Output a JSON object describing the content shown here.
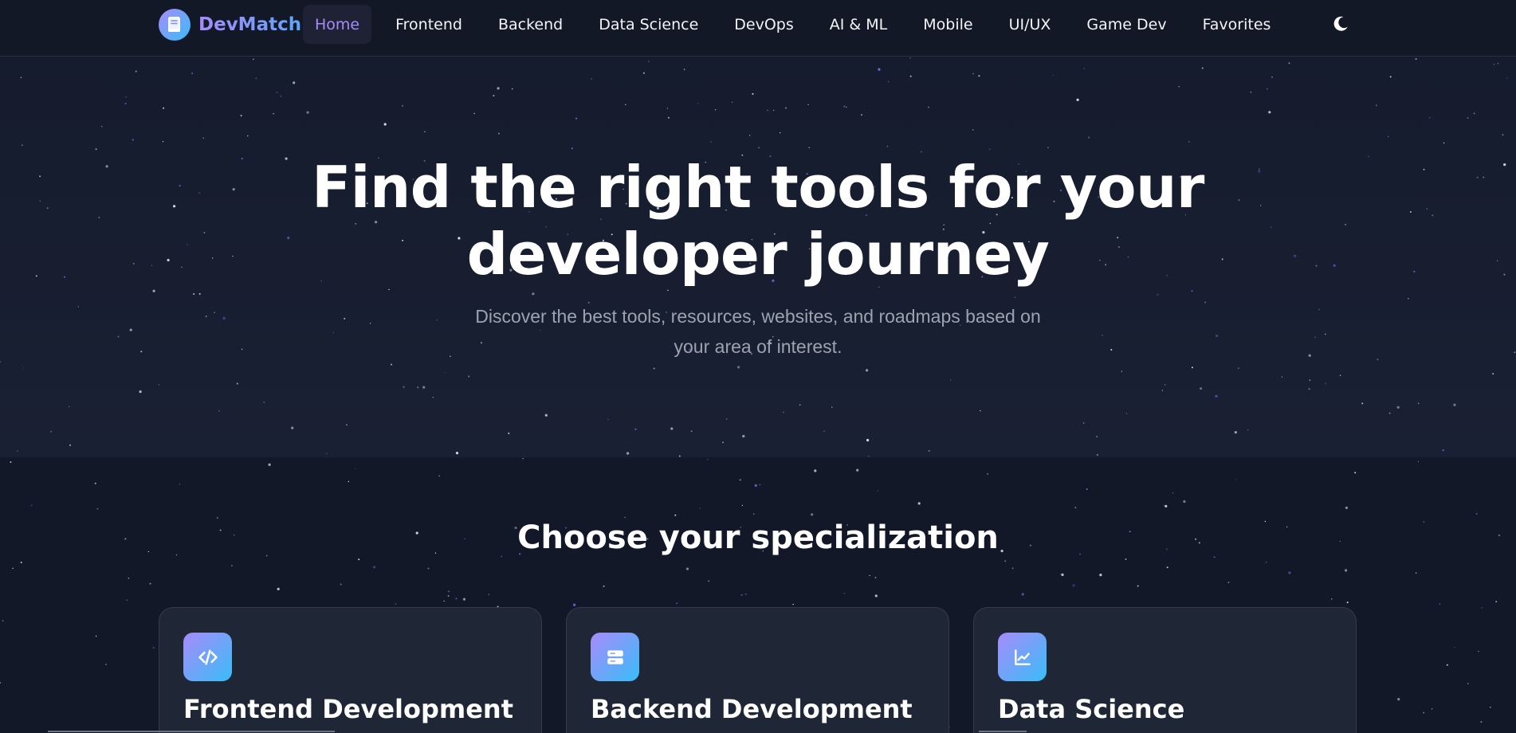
{
  "brand": {
    "name": "DevMatch",
    "icon": "book-icon"
  },
  "nav": {
    "items": [
      {
        "label": "Home",
        "active": true
      },
      {
        "label": "Frontend",
        "active": false
      },
      {
        "label": "Backend",
        "active": false
      },
      {
        "label": "Data Science",
        "active": false
      },
      {
        "label": "DevOps",
        "active": false
      },
      {
        "label": "AI & ML",
        "active": false
      },
      {
        "label": "Mobile",
        "active": false
      },
      {
        "label": "UI/UX",
        "active": false
      },
      {
        "label": "Game Dev",
        "active": false
      },
      {
        "label": "Favorites",
        "active": false
      }
    ],
    "theme_icon": "moon-icon"
  },
  "hero": {
    "title_line1": "Find the right tools for your",
    "title_line2": "developer journey",
    "subtitle_line1": "Discover the best tools, resources, websites, and roadmaps based on",
    "subtitle_line2": "your area of interest."
  },
  "section": {
    "title": "Choose your specialization",
    "cards": [
      {
        "title": "Frontend Development",
        "icon": "code-icon"
      },
      {
        "title": "Backend Development",
        "icon": "server-icon"
      },
      {
        "title": "Data Science",
        "icon": "chart-line-icon"
      }
    ]
  },
  "colors": {
    "background": "#121828",
    "accent_purple": "#a78bfa",
    "accent_blue": "#38bdf8",
    "card_bg": "#1f2737"
  }
}
